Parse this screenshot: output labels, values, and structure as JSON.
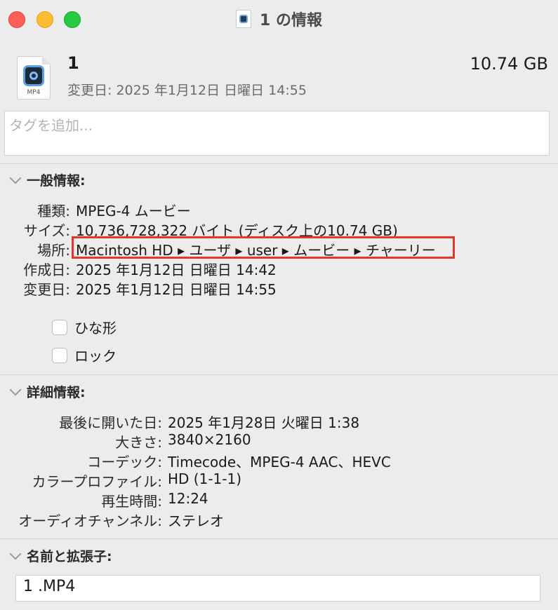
{
  "window": {
    "title": "1 の情報",
    "title_icon": "quicktime-file-icon"
  },
  "file": {
    "name": "1",
    "size": "10.74 GB",
    "modified": "変更日: 2025 年1月12日 日曜日 14:55",
    "icon_ext": "MP4"
  },
  "tags": {
    "placeholder": "タグを追加..."
  },
  "general": {
    "title": "一般情報:",
    "rows": [
      {
        "label": "種類:",
        "value": "MPEG-4 ムービー"
      },
      {
        "label": "サイズ:",
        "value": "10,736,728,322 バイト (ディスク上の10.74 GB)"
      },
      {
        "label": "場所:",
        "value": "Macintosh HD ▸ ユーザ ▸ user ▸ ムービー ▸ チャーリー"
      },
      {
        "label": "作成日:",
        "value": "2025 年1月12日 日曜日 14:42"
      },
      {
        "label": "変更日:",
        "value": "2025 年1月12日 日曜日 14:55"
      }
    ],
    "checkboxes": [
      {
        "label": "ひな形",
        "checked": false
      },
      {
        "label": "ロック",
        "checked": false
      }
    ]
  },
  "details": {
    "title": "詳細情報:",
    "rows": [
      {
        "label": "最後に開いた日:",
        "value": "2025 年1月28日 火曜日 1:38"
      },
      {
        "label": "大きさ:",
        "value": "3840×2160"
      },
      {
        "label": "コーデック:",
        "value": "Timecode、MPEG-4 AAC、HEVC"
      },
      {
        "label": "カラープロファイル:",
        "value": "HD (1-1-1)"
      },
      {
        "label": "再生時間:",
        "value": "12:24"
      },
      {
        "label": "オーディオチャンネル:",
        "value": "ステレオ"
      }
    ]
  },
  "name_ext": {
    "title": "名前と拡張子:",
    "value": "1 .MP4"
  },
  "colors": {
    "highlight": "#e8352a",
    "close": "#fe5f57",
    "minimize": "#febc2e",
    "zoom": "#28c840"
  }
}
